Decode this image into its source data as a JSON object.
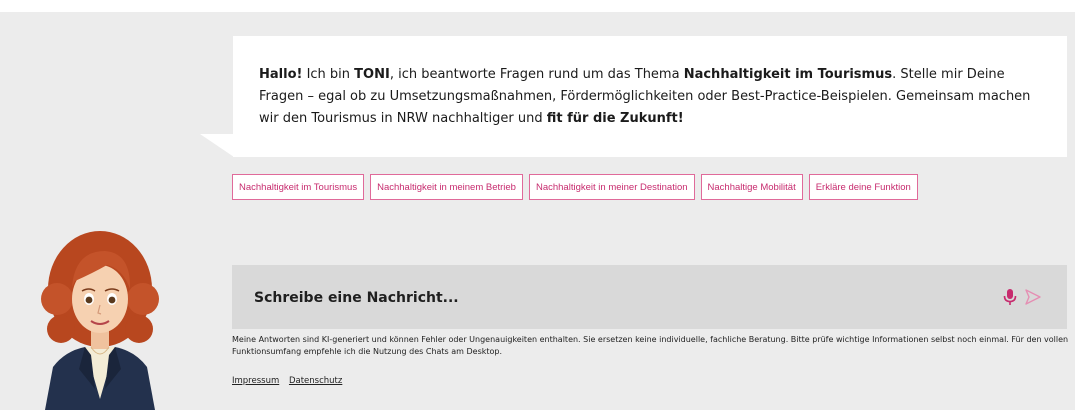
{
  "bubble": {
    "greeting": "Hallo!",
    "t1": " Ich bin ",
    "name": "TONI",
    "t2": ", ich beantworte Fragen rund um das Thema ",
    "topic": "Nachhaltigkeit im Tourismus",
    "t3": ". Stelle mir Deine Fragen – egal ob zu Umsetzungsmaßnahmen, Fördermöglichkeiten oder Best-Practice-Beispielen. Gemeinsam machen wir den Tourismus in NRW nachhaltiger und ",
    "closing": "fit für die Zukunft!"
  },
  "chips": [
    "Nachhaltigkeit im Tourismus",
    "Nachhaltigkeit in meinem Betrieb",
    "Nachhaltigkeit in meiner Destination",
    "Nachhaltige Mobilität",
    "Erkläre deine Funktion"
  ],
  "composer": {
    "placeholder": "Schreibe eine Nachricht...",
    "mic_icon": "microphone-icon",
    "send_icon": "send-icon"
  },
  "disclaimer": "Meine Antworten sind KI-generiert und können Fehler oder Ungenauigkeiten enthalten. Sie ersetzen keine individuelle, fachliche Beratung. Bitte prüfe wichtige Informationen selbst noch einmal. Für den vollen Funktionsumfang empfehle ich die Nutzung des Chats am Desktop.",
  "links": {
    "impressum": "Impressum",
    "datenschutz": "Datenschutz"
  },
  "colors": {
    "accent": "#c72b6e",
    "background": "#ececec",
    "composer": "#d9d9d9"
  }
}
